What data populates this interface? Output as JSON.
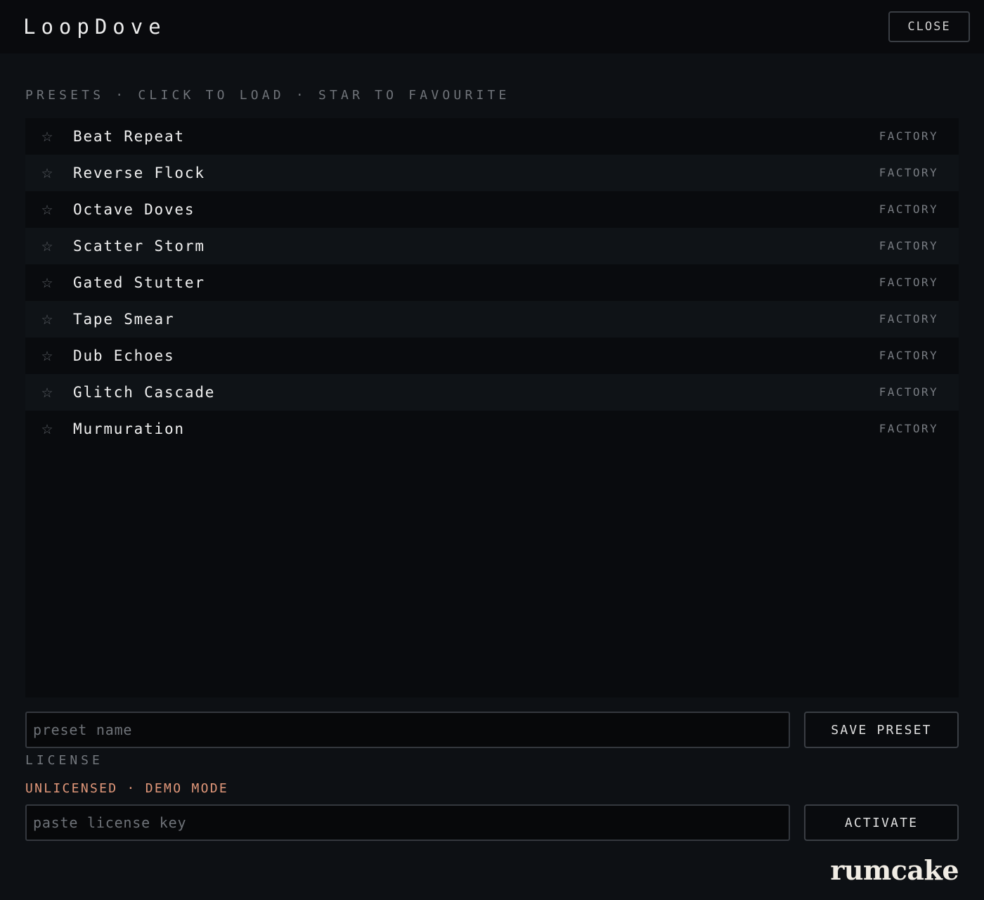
{
  "header": {
    "app_title": "LoopDove",
    "close_label": "CLOSE"
  },
  "presets": {
    "section_label": "PRESETS · CLICK TO LOAD · STAR TO FAVOURITE",
    "items": [
      {
        "name": "Beat Repeat",
        "tag": "FACTORY",
        "favourite": false
      },
      {
        "name": "Reverse Flock",
        "tag": "FACTORY",
        "favourite": false
      },
      {
        "name": "Octave Doves",
        "tag": "FACTORY",
        "favourite": false
      },
      {
        "name": "Scatter Storm",
        "tag": "FACTORY",
        "favourite": false
      },
      {
        "name": "Gated Stutter",
        "tag": "FACTORY",
        "favourite": false
      },
      {
        "name": "Tape Smear",
        "tag": "FACTORY",
        "favourite": false
      },
      {
        "name": "Dub Echoes",
        "tag": "FACTORY",
        "favourite": false
      },
      {
        "name": "Glitch Cascade",
        "tag": "FACTORY",
        "favourite": false
      },
      {
        "name": "Murmuration",
        "tag": "FACTORY",
        "favourite": false
      }
    ],
    "star_glyph": "☆",
    "star_icon": "star-outline-icon"
  },
  "save": {
    "input_value": "",
    "input_placeholder": "preset name",
    "button_label": "SAVE PRESET"
  },
  "license": {
    "label": "LICENSE",
    "status": "UNLICENSED · DEMO MODE",
    "status_color": "#e2987a",
    "input_value": "",
    "input_placeholder": "paste license key",
    "button_label": "ACTIVATE"
  },
  "brand": {
    "logo_text": "rumcake"
  }
}
